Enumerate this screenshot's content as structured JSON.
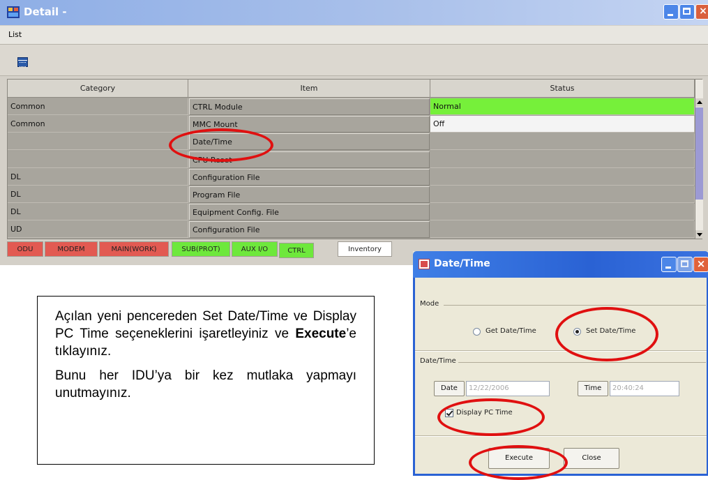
{
  "window": {
    "title": "Detail -",
    "menu_list": "List",
    "buttons": {
      "close": "×"
    }
  },
  "table": {
    "headers": [
      "Category",
      "Item",
      "Status"
    ],
    "rows": [
      {
        "category": "Common",
        "item": "CTRL Module",
        "status": "Normal"
      },
      {
        "category": "Common",
        "item": "MMC Mount",
        "status": "Off"
      },
      {
        "category": "",
        "item": "Date/Time",
        "status": ""
      },
      {
        "category": "",
        "item": "CPU Reset",
        "status": ""
      },
      {
        "category": "DL",
        "item": "Configuration File",
        "status": ""
      },
      {
        "category": "DL",
        "item": "Program File",
        "status": ""
      },
      {
        "category": "DL",
        "item": "Equipment Config. File",
        "status": ""
      },
      {
        "category": "UD",
        "item": "Configuration File",
        "status": ""
      }
    ]
  },
  "tabs": [
    {
      "label": "ODU",
      "color": "#e25a52"
    },
    {
      "label": "MODEM",
      "color": "#e25a52"
    },
    {
      "label": "MAIN(WORK)",
      "color": "#e25a52"
    },
    {
      "label": "SUB(PROT)",
      "color": "#6ee83c"
    },
    {
      "label": "AUX I/O",
      "color": "#6ee83c"
    },
    {
      "label": "CTRL",
      "color": "#6ee83c"
    },
    {
      "label": "Inventory",
      "color": "#ffffff"
    }
  ],
  "note": {
    "p1_text": "Açılan yeni pencereden Set Date/Time ve Display PC Time seçeneklerini işaretleyiniz ve",
    "p1_bold": "Execute",
    "p1_tail": "’e tıklayınız.",
    "p2": "Bunu her IDU’ya bir kez mutlaka yapmayı unutmayınız."
  },
  "dialog": {
    "title": "Date/Time",
    "close_glyph": "×",
    "mode_label": "Mode",
    "get_option": "Get Date/Time",
    "set_option": "Set Date/Time",
    "selected_option": "Set Date/Time",
    "datetime_label": "Date/Time",
    "date_button": "Date",
    "date_value": "12/22/2006",
    "time_button": "Time",
    "time_value": "20:40:24",
    "display_pc_time": "Display PC Time",
    "display_pc_time_checked": true,
    "execute_button": "Execute",
    "close_button": "Close"
  },
  "colors": {
    "status_normal": "#76f03a",
    "annotation": "#e01010",
    "dialog_titlebar": "#2a62d4"
  }
}
